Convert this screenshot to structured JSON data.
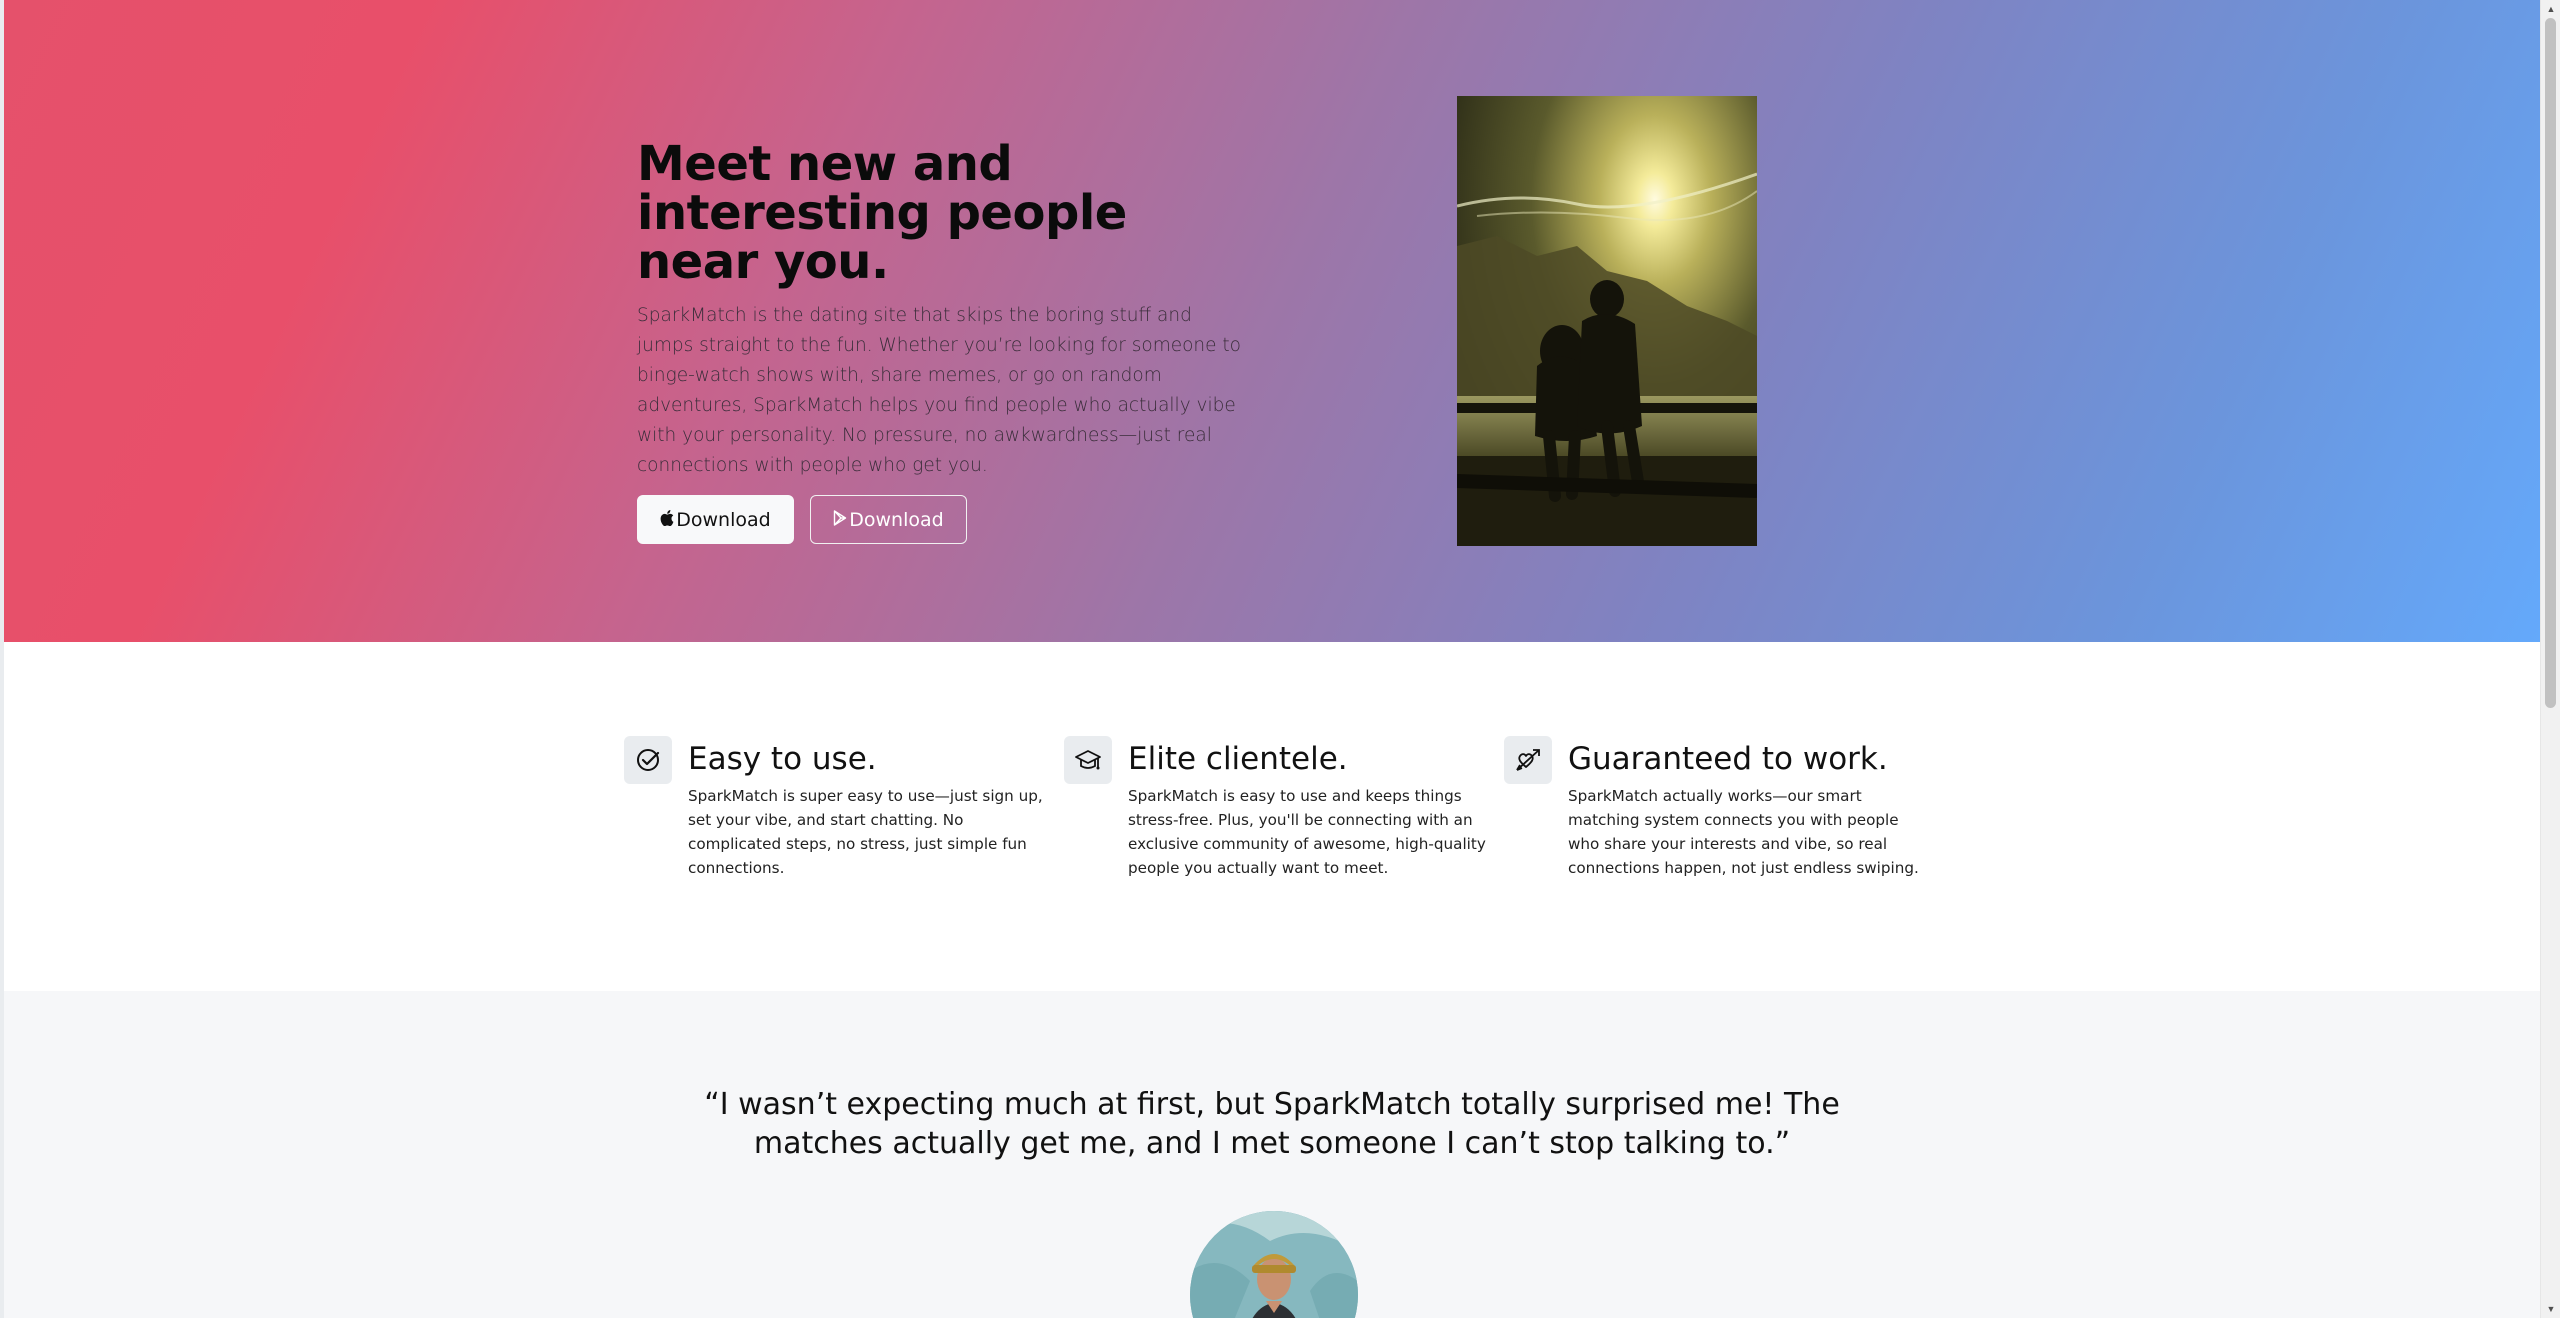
{
  "hero": {
    "title": "Meet new and interesting people near you.",
    "description": "SparkMatch is the dating site that skips the boring stuff and jumps straight to the fun. Whether you’re looking for someone to binge-watch shows with, share memes, or go on random adventures, SparkMatch helps you find people who actually vibe with your personality. No pressure, no awkwardness—just real connections with people who get you.",
    "buttons": [
      {
        "label": "Download",
        "icon": "apple-icon"
      },
      {
        "label": "Download",
        "icon": "play-store-icon"
      }
    ]
  },
  "features": [
    {
      "icon": "check-circle-icon",
      "title": "Easy to use.",
      "description": "SparkMatch is super easy to use—just sign up, set your vibe, and start chatting. No complicated steps, no stress, just simple fun connections."
    },
    {
      "icon": "graduation-cap-icon",
      "title": "Elite clientele.",
      "description": "SparkMatch is easy to use and keeps things stress-free. Plus, you'll be connecting with an exclusive community of awesome, high-quality people you actually want to meet."
    },
    {
      "icon": "arrow-heart-icon",
      "title": "Guaranteed to work.",
      "description": "SparkMatch actually works—our smart matching system connects you with people who share your interests and vibe, so real connections happen, not just endless swiping."
    }
  ],
  "testimonial": {
    "quote": "“I wasn’t expecting much at first, but SparkMatch totally surprised me! The matches actually get me, and I met someone I can’t stop talking to.”"
  },
  "colors": {
    "hero_gradient_start": "#e5516b",
    "hero_gradient_end": "#64a9fb",
    "testimonial_bg": "#f6f7f9"
  }
}
